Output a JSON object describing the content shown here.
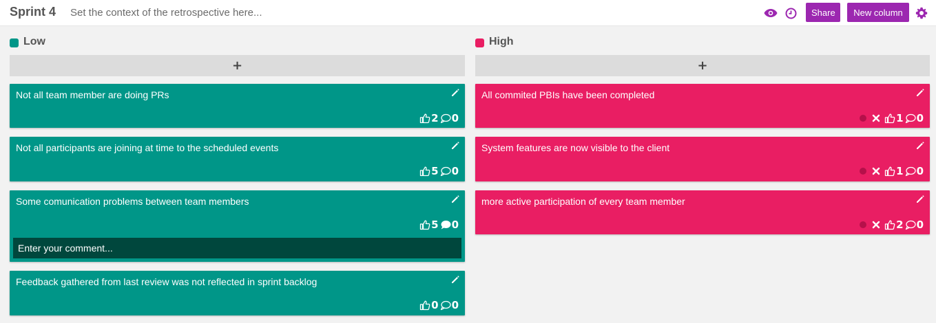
{
  "header": {
    "sprint_title": "Sprint 4",
    "context_placeholder": "Set the context of the retrospective here...",
    "share_label": "Share",
    "new_column_label": "New column",
    "icons": [
      "eye-icon",
      "clock-icon",
      "gear-icon"
    ],
    "accent_color": "#9c27b0"
  },
  "columns": [
    {
      "title": "Low",
      "color": "#009688",
      "add_label": "+",
      "cards": [
        {
          "text": "Not all team member are doing PRs",
          "likes": "2",
          "comments": "0"
        },
        {
          "text": "Not all participants are joining at time to the scheduled events",
          "likes": "5",
          "comments": "0"
        },
        {
          "text": "Some comunication problems between team members",
          "likes": "5",
          "comments": "0",
          "comment_placeholder": "Enter your comment..."
        },
        {
          "text": "Feedback gathered from last review was not reflected in sprint backlog",
          "likes": "0",
          "comments": "0"
        }
      ]
    },
    {
      "title": "High",
      "color": "#e91e63",
      "add_label": "+",
      "cards": [
        {
          "text": "All commited PBIs have been completed",
          "likes": "1",
          "comments": "0"
        },
        {
          "text": "System features are now visible to the client",
          "likes": "1",
          "comments": "0"
        },
        {
          "text": "more active participation of every team member",
          "likes": "2",
          "comments": "0"
        }
      ]
    }
  ]
}
